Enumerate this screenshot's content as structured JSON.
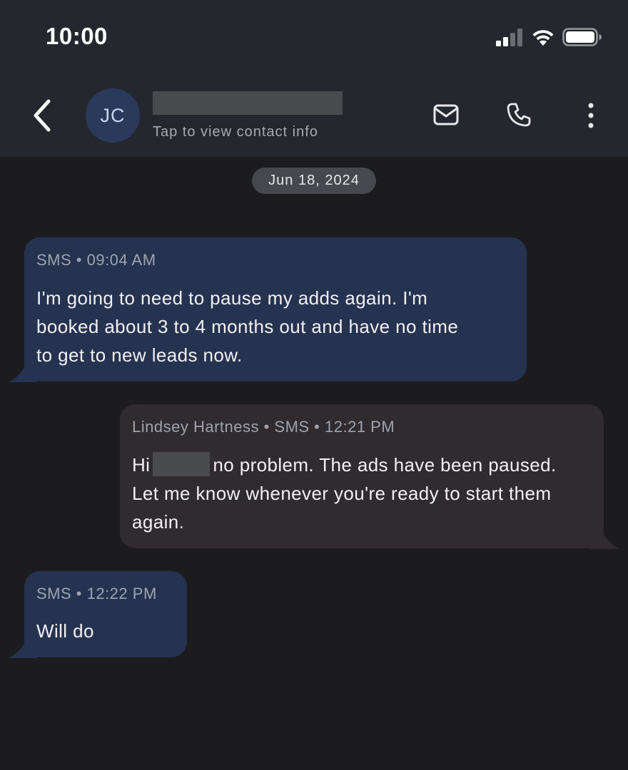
{
  "status_bar": {
    "time": "10:00"
  },
  "header": {
    "avatar_initials": "JC",
    "contact_subtitle": "Tap to view contact info"
  },
  "conversation": {
    "date_divider": "Jun 18, 2024",
    "messages": [
      {
        "direction": "incoming",
        "meta": "SMS • 09:04 AM",
        "lines": [
          "I'm going to need to pause my adds again.  I'm",
          "booked about 3 to 4 months out and have no time",
          "to get to new leads now."
        ]
      },
      {
        "direction": "outgoing",
        "meta": "Lindsey Hartness • SMS • 12:21 PM",
        "greeting": "Hi",
        "line1_rest": "no problem. The ads have been paused.",
        "lines": [
          "Let me know whenever you're ready to start them",
          "again."
        ]
      },
      {
        "direction": "incoming",
        "meta": "SMS • 12:22 PM",
        "lines": [
          "Will do"
        ]
      }
    ]
  },
  "colors": {
    "header_bg": "#25272e",
    "chat_bg": "#1c1c1e",
    "incoming_bubble": "#253250",
    "outgoing_bubble": "#2f2b2f",
    "date_pill": "#47484d",
    "redaction": "#4a4b4f"
  },
  "icons": [
    "back-chevron-icon",
    "mail-icon",
    "phone-icon",
    "more-vertical-icon",
    "cellular-signal-icon",
    "wifi-icon",
    "battery-icon"
  ]
}
